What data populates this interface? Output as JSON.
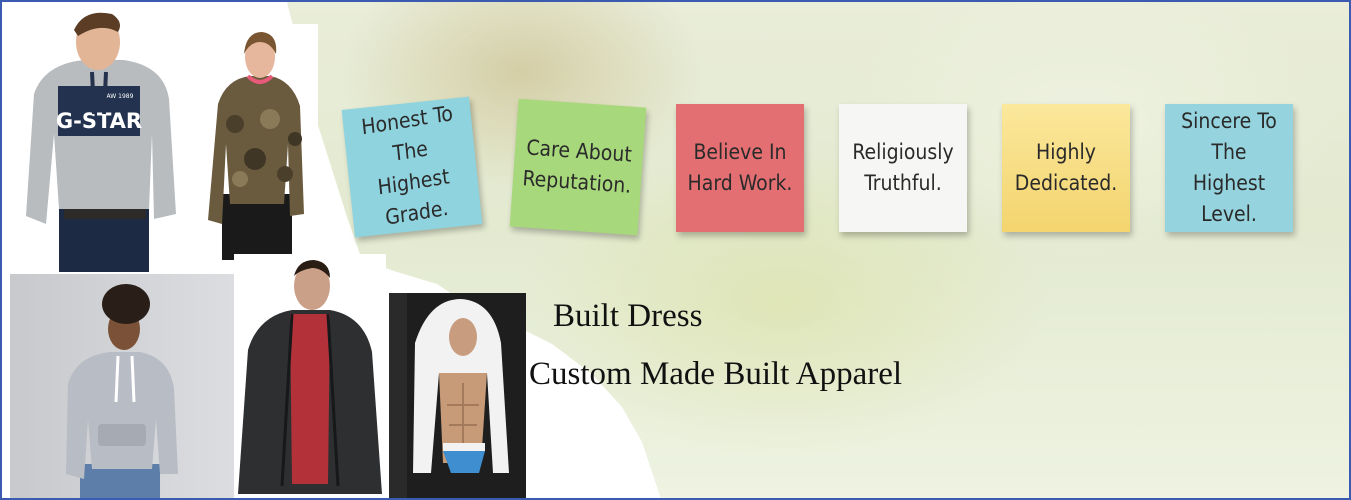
{
  "banner": {
    "notes": [
      {
        "text": "Honest To The\nHighest Grade.",
        "color": "#8fd3df"
      },
      {
        "text": "Care About\nReputation.",
        "color": "#a8d87c"
      },
      {
        "text": "Believe In\nHard Work.",
        "color": "#e46f73"
      },
      {
        "text": "Religiously\nTruthful.",
        "color": "#f6f6f4"
      },
      {
        "text": "Highly\nDedicated.",
        "color": "#f6dc7e"
      },
      {
        "text": "Sincere To The\nHighest Level.",
        "color": "#95d4de"
      }
    ],
    "heading": "Built Dress",
    "subheading": "Custom Made Built Apparel",
    "shirt_print": "G-STAR",
    "shirt_print_small": "RAW 1989",
    "border_color": "#3a5bb0"
  }
}
